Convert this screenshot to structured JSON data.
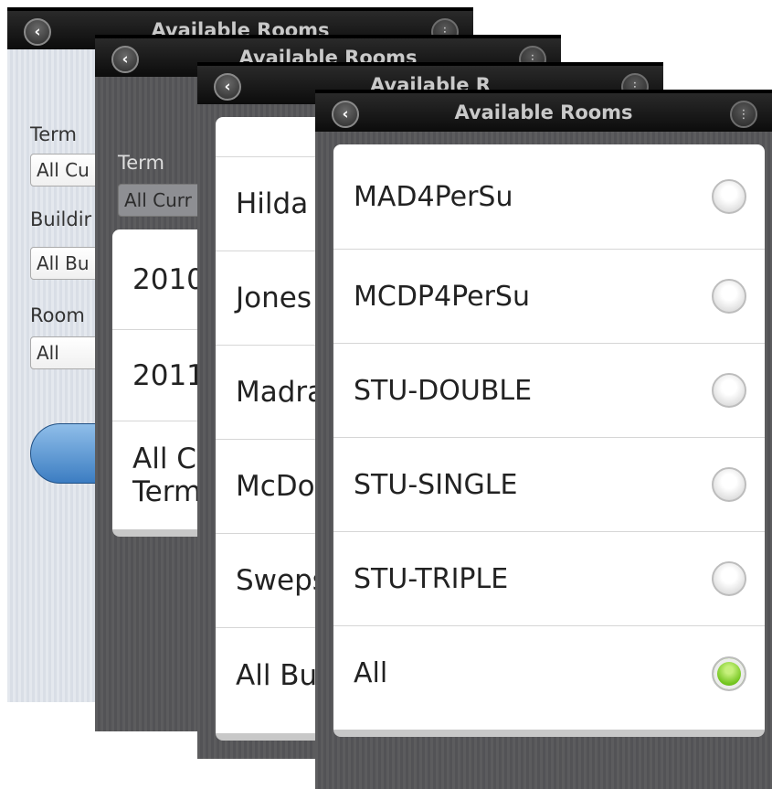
{
  "screen1": {
    "header": {
      "title": "Available Rooms",
      "back_icon": "back-arrow-icon",
      "menu_icon": "grid-icon"
    },
    "form": {
      "term_label": "Term",
      "term_value": "All Cu",
      "building_label": "Buildir",
      "building_value": "All Bu",
      "room_label": "Room",
      "room_value": "All"
    }
  },
  "screen2": {
    "header": {
      "title": "Available Rooms",
      "back_icon": "back-arrow-icon",
      "menu_icon": "grid-icon"
    },
    "form": {
      "term_label": "Term",
      "term_value": "All Curr"
    },
    "term_options": [
      "2010",
      "2011",
      "All C",
      "Term"
    ]
  },
  "screen3": {
    "header": {
      "title": "Available R",
      "back_icon": "back-arrow-icon",
      "menu_icon": "grid-icon"
    },
    "building_options": [
      "Hilda",
      "Jones",
      "Madra",
      "McDo",
      "Sweps",
      "All Bu"
    ]
  },
  "screen4": {
    "header": {
      "title": "Available Rooms",
      "back_icon": "back-arrow-icon",
      "menu_icon": "grid-icon"
    },
    "room_options": [
      {
        "label": "MAD4PerSu",
        "selected": false
      },
      {
        "label": "MCDP4PerSu",
        "selected": false
      },
      {
        "label": "STU-DOUBLE",
        "selected": false
      },
      {
        "label": "STU-SINGLE",
        "selected": false
      },
      {
        "label": "STU-TRIPLE",
        "selected": false
      },
      {
        "label": "All",
        "selected": true
      }
    ]
  },
  "colors": {
    "selected_radio": "#74c620",
    "button_blue": "#3c7dc2",
    "titlebar": "#111111"
  }
}
